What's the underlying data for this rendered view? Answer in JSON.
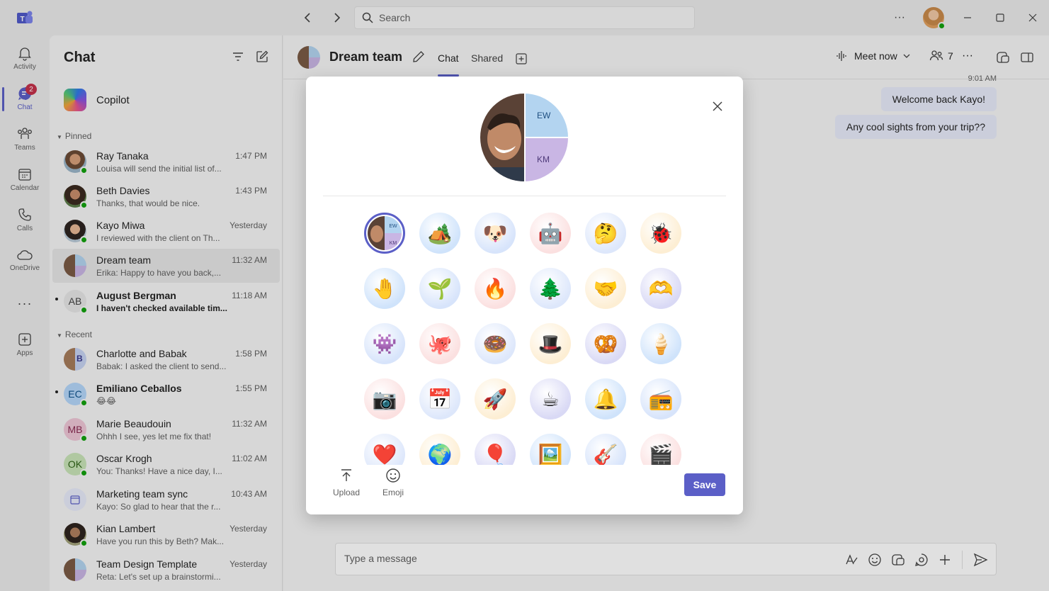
{
  "titlebar": {
    "search_placeholder": "Search"
  },
  "rail": [
    {
      "label": "Activity",
      "icon": "bell-icon"
    },
    {
      "label": "Chat",
      "icon": "chat-icon",
      "badge": "2"
    },
    {
      "label": "Teams",
      "icon": "people-icon"
    },
    {
      "label": "Calendar",
      "icon": "calendar-icon"
    },
    {
      "label": "Calls",
      "icon": "phone-icon"
    },
    {
      "label": "OneDrive",
      "icon": "cloud-icon"
    },
    {
      "label": "Apps",
      "icon": "add-app-icon"
    }
  ],
  "chatlist": {
    "title": "Chat",
    "copilot": "Copilot",
    "pinned_label": "Pinned",
    "recent_label": "Recent",
    "pinned": [
      {
        "name": "Ray Tanaka",
        "time": "1:47 PM",
        "preview": "Louisa will send the initial list of..."
      },
      {
        "name": "Beth Davies",
        "time": "1:43 PM",
        "preview": "Thanks, that would be nice."
      },
      {
        "name": "Kayo Miwa",
        "time": "Yesterday",
        "preview": "I reviewed with the client on Th..."
      },
      {
        "name": "Dream team",
        "time": "11:32 AM",
        "preview": "Erika: Happy to have you back,..."
      },
      {
        "name": "August Bergman",
        "initials": "AB",
        "time": "11:18 AM",
        "preview": "I haven't checked available tim..."
      }
    ],
    "recent": [
      {
        "name": "Charlotte and Babak",
        "time": "1:58 PM",
        "preview": "Babak: I asked the client to send..."
      },
      {
        "name": "Emiliano Ceballos",
        "initials": "EC",
        "time": "1:55 PM",
        "preview": "😂😂"
      },
      {
        "name": "Marie Beaudouin",
        "initials": "MB",
        "time": "11:32 AM",
        "preview": "Ohhh I see, yes let me fix that!"
      },
      {
        "name": "Oscar Krogh",
        "initials": "OK",
        "time": "11:02 AM",
        "preview": "You: Thanks! Have a nice day, I..."
      },
      {
        "name": "Marketing team sync",
        "time": "10:43 AM",
        "preview": "Kayo: So glad to hear that the r..."
      },
      {
        "name": "Kian Lambert",
        "time": "Yesterday",
        "preview": "Have you run this by Beth? Mak..."
      },
      {
        "name": "Team Design Template",
        "time": "Yesterday",
        "preview": "Reta: Let's set up a brainstormi..."
      }
    ]
  },
  "main": {
    "title": "Dream team",
    "tabs": [
      "Chat",
      "Shared"
    ],
    "meet_now": "Meet now",
    "participants": "7",
    "timestamp": "9:01 AM",
    "messages": [
      "Welcome back Kayo!",
      "Any cool sights from your trip??"
    ],
    "composer_placeholder": "Type a message"
  },
  "dialog": {
    "initials_1": "EW",
    "initials_2": "KM",
    "upload_label": "Upload",
    "emoji_label": "Emoji",
    "save_label": "Save",
    "options": [
      "group-photo",
      "landscape-icon",
      "dog-icon",
      "robot-icon",
      "thinking-face-icon",
      "bug-icon",
      "hand-icon",
      "plant-icon",
      "hands-flame-icon",
      "tree-icon",
      "handshake-icon",
      "heart-hands-icon",
      "creature-icon",
      "octopus-icon",
      "donut-icon",
      "magic-hat-icon",
      "pretzel-icon",
      "ice-cream-icon",
      "camera-icon",
      "calendar-icon",
      "rocket-icon",
      "teacup-icon",
      "bell-icon",
      "boombox-icon",
      "heart-icon",
      "globe-icon",
      "balloon-icon",
      "gallery-icon",
      "guitar-icon",
      "video-icon"
    ],
    "emoji": [
      "",
      "🏕️",
      "🐶",
      "🤖",
      "🤔",
      "🐞",
      "🤚",
      "🌱",
      "🔥",
      "🌲",
      "🤝",
      "🫶",
      "👾",
      "🐙",
      "🍩",
      "🎩",
      "🥨",
      "🍦",
      "📷",
      "📅",
      "🚀",
      "☕",
      "🔔",
      "📻",
      "❤️",
      "🌍",
      "🎈",
      "🖼️",
      "🎸",
      "🎬"
    ]
  }
}
